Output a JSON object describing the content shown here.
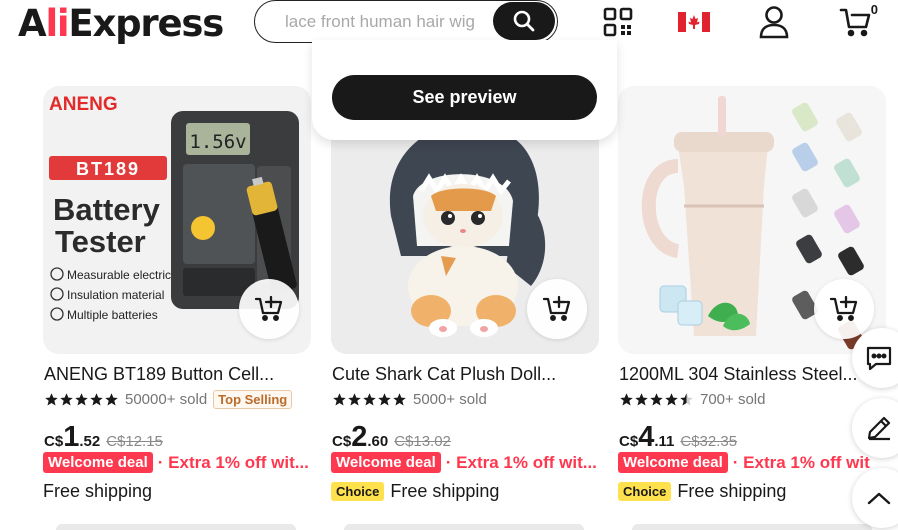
{
  "header": {
    "logo_prefix": "A",
    "logo_accent": "li",
    "logo_suffix": "Express",
    "search_placeholder": "lace front human hair wig",
    "icons": [
      "qr-code-icon",
      "canada-flag-icon",
      "account-icon",
      "cart-icon"
    ],
    "cart_count": "0"
  },
  "preview": {
    "button_label": "See preview"
  },
  "colors": {
    "accent": "#fd384f",
    "choice": "#ffe14d",
    "dark": "#191919"
  },
  "products": [
    {
      "title": "ANENG BT189 Button Cell...",
      "rating": 5,
      "sold": "50000+ sold",
      "badge": "Top Selling",
      "currency": "C$",
      "price_whole": "1",
      "price_cents": ".52",
      "old_price": "C$12.15",
      "deal_label": "Welcome deal",
      "extra": "· Extra 1% off wit...",
      "choice": "",
      "shipping": "Free shipping",
      "image": {
        "brand": "ANENG",
        "model": "BT189",
        "line1": "Battery",
        "line2": "Tester",
        "screen": "1.56v",
        "features": [
          "Measurable electricity",
          "Insulation material",
          "Multiple batteries"
        ]
      }
    },
    {
      "title": "Cute Shark Cat Plush Doll...",
      "rating": 5,
      "sold": "5000+ sold",
      "badge": "",
      "currency": "C$",
      "price_whole": "2",
      "price_cents": ".60",
      "old_price": "C$13.02",
      "deal_label": "Welcome deal",
      "extra": "· Extra 1% off wit...",
      "choice": "Choice",
      "shipping": "Free shipping"
    },
    {
      "title": "1200ML 304 Stainless Steel...",
      "rating": 4.5,
      "sold": "700+ sold",
      "badge": "",
      "currency": "C$",
      "price_whole": "4",
      "price_cents": ".11",
      "old_price": "C$32.35",
      "deal_label": "Welcome deal",
      "extra": "· Extra 1% off wit",
      "choice": "Choice",
      "shipping": "Free shipping"
    }
  ],
  "side_buttons": [
    "chat-icon",
    "edit-icon",
    "chevron-up-icon"
  ]
}
